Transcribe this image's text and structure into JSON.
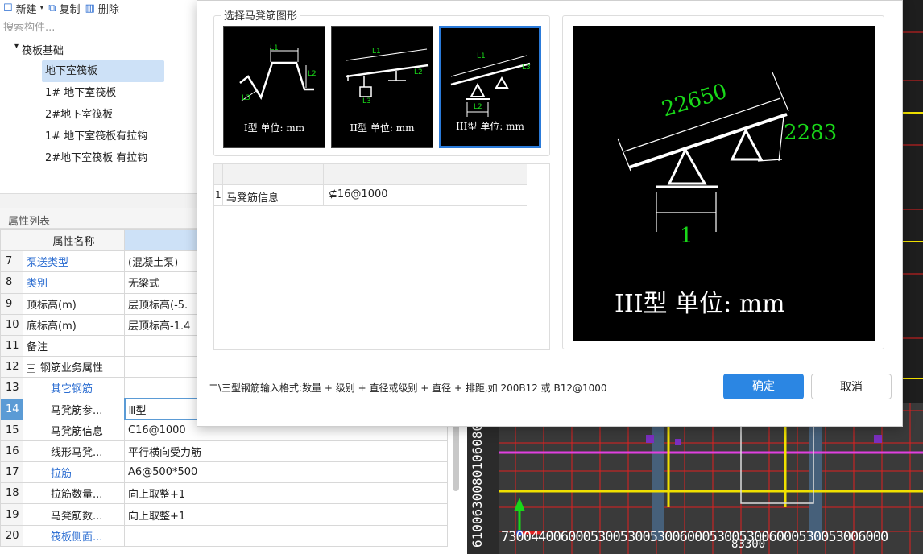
{
  "toolbar": {
    "new_label": "新建",
    "copy_label": "复制",
    "delete_label": "删除"
  },
  "search": {
    "placeholder": "搜索构件..."
  },
  "tree": {
    "root_label": "筏板基础",
    "items": [
      {
        "label": "地下室筏板"
      },
      {
        "label": "1# 地下室筏板"
      },
      {
        "label": "2#地下室筏板"
      },
      {
        "label": "1# 地下室筏板有拉钩"
      },
      {
        "label": "2#地下室筏板 有拉钩"
      }
    ]
  },
  "properties": {
    "title": "属性列表",
    "header_name": "属性名称",
    "rows": [
      {
        "num": "7",
        "name": "泵送类型",
        "value": "(混凝土泵)"
      },
      {
        "num": "8",
        "name": "类别",
        "value": "无梁式"
      },
      {
        "num": "9",
        "name": "顶标高(m)",
        "value": "层顶标高(-5."
      },
      {
        "num": "10",
        "name": "底标高(m)",
        "value": "层顶标高-1.4"
      },
      {
        "num": "11",
        "name": "备注",
        "value": ""
      },
      {
        "num": "12",
        "name": "钢筋业务属性",
        "value": ""
      },
      {
        "num": "13",
        "name": "其它钢筋",
        "value": ""
      },
      {
        "num": "14",
        "name": "马凳筋参...",
        "value": "Ⅲ型"
      },
      {
        "num": "15",
        "name": "马凳筋信息",
        "value": "C16@1000"
      },
      {
        "num": "16",
        "name": "线形马凳...",
        "value": "平行横向受力筋"
      },
      {
        "num": "17",
        "name": "拉筋",
        "value": "A6@500*500"
      },
      {
        "num": "18",
        "name": "拉筋数量...",
        "value": "向上取整+1"
      },
      {
        "num": "19",
        "name": "马凳筋数...",
        "value": "向上取整+1"
      },
      {
        "num": "20",
        "name": "筏板侧面...",
        "value": ""
      }
    ]
  },
  "dialog": {
    "group_title": "选择马凳筋图形",
    "shapes": [
      {
        "caption": "I型 单位: mm"
      },
      {
        "caption": "II型 单位: mm"
      },
      {
        "caption": "III型 单位: mm"
      }
    ],
    "thumb_labels": {
      "l1": "L1",
      "l2": "L2",
      "l3": "L3"
    },
    "grid_row": {
      "num": "1",
      "key": "马凳筋信息",
      "value": "⊈16@1000"
    },
    "preview": {
      "dim_length": "22650",
      "dim_height": "2283",
      "dim_base": "1",
      "caption": "III型  单位: mm"
    },
    "hint": "二\\三型钢筋输入格式:数量 + 级别 + 直径或级别 + 直径 + 排距,如 200B12 或 B12@1000",
    "ok_label": "确定",
    "cancel_label": "取消"
  },
  "cad": {
    "bottom_numbers": "7300440060005300530053006000530053006000530053006000",
    "bottom_numbers2": "83300",
    "side_numbers": "6100630080106080"
  },
  "colors": {
    "accent": "#2b86e3",
    "selection": "#cde1f7",
    "cad_green": "#19d819",
    "cad_red": "#e02020",
    "cad_yellow": "#f0e000",
    "cad_magenta": "#e040e0"
  }
}
